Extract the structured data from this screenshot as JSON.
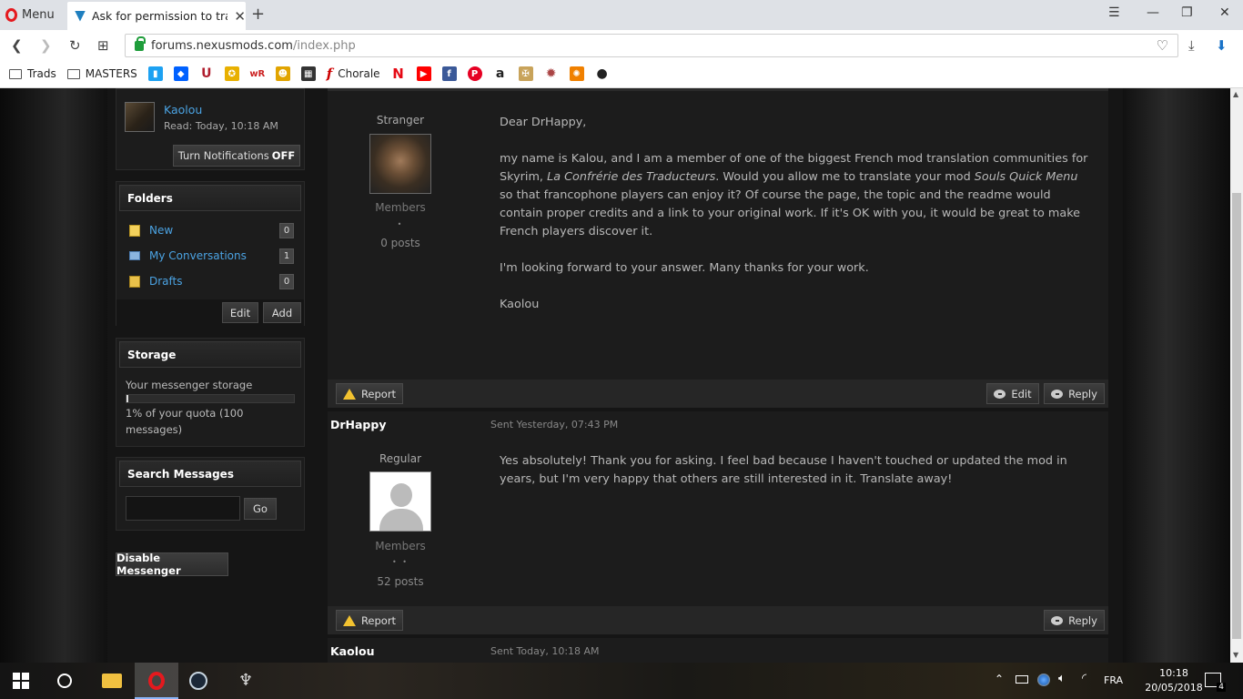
{
  "browser": {
    "menu_label": "Menu",
    "tab_title": "Ask for permission to tran",
    "url_host": "forums.nexusmods.com",
    "url_path": "/index.php",
    "bookmarks": [
      {
        "label": "Trads",
        "icon": "folder-icon"
      },
      {
        "label": "MASTERS",
        "icon": "folder-icon"
      },
      {
        "label": "Chorale",
        "icon": "f-logo-icon"
      }
    ]
  },
  "sidebar": {
    "user": {
      "name": "Kaolou",
      "read": "Read: Today, 10:18 AM"
    },
    "notifications_button": {
      "prefix": "Turn Notifications",
      "state": "OFF"
    },
    "folders": {
      "title": "Folders",
      "items": [
        {
          "label": "New",
          "count": "0",
          "icon": "document-icon"
        },
        {
          "label": "My Conversations",
          "count": "1",
          "icon": "envelope-icon"
        },
        {
          "label": "Drafts",
          "count": "0",
          "icon": "draft-icon"
        }
      ],
      "edit_label": "Edit",
      "add_label": "Add"
    },
    "storage": {
      "title": "Storage",
      "label": "Your messenger storage",
      "quota_line1": "1% of your quota (100",
      "quota_line2": "messages)",
      "percent": 1
    },
    "search": {
      "title": "Search Messages",
      "go_label": "Go",
      "value": ""
    },
    "disable_label": "Disable Messenger"
  },
  "posts": [
    {
      "rank": "Stranger",
      "group": "Members",
      "pips": "•",
      "posts": "0 posts",
      "greeting": "Dear DrHappy,",
      "body_a": "my name is Kalou, and I am a member of one of the biggest French mod translation communities for Skyrim, ",
      "body_em1": "La Confrérie des Traducteurs",
      "body_b": ". Would you allow me to translate your mod ",
      "body_em2": "Souls Quick Menu",
      "body_c": " so that francophone players can enjoy it? Of course the page, the topic and the readme would contain proper credits and a link to your original work. If it's OK with you, it would be great to make French players discover it.",
      "body_p3": "I'm looking forward to your answer. Many thanks for your work.",
      "signature": "Kaolou",
      "report_label": "Report",
      "edit_label": "Edit",
      "reply_label": "Reply"
    },
    {
      "author": "DrHappy",
      "date": "Sent Yesterday, 07:43 PM",
      "rank": "Regular",
      "group": "Members",
      "pips": "• •",
      "posts": "52 posts",
      "body": "Yes absolutely!  Thank you for asking.  I feel bad because I haven't touched or updated the mod in years, but I'm very happy that others are still interested in it.  Translate away!",
      "report_label": "Report",
      "reply_label": "Reply"
    },
    {
      "author": "Kaolou",
      "date": "Sent Today, 10:18 AM"
    }
  ],
  "taskbar": {
    "lang": "FRA",
    "time": "10:18",
    "date": "20/05/2018",
    "notifications": "4"
  },
  "colors": {
    "link": "#4ba3e3",
    "warning": "#f2c230",
    "opera": "#e5191e"
  }
}
